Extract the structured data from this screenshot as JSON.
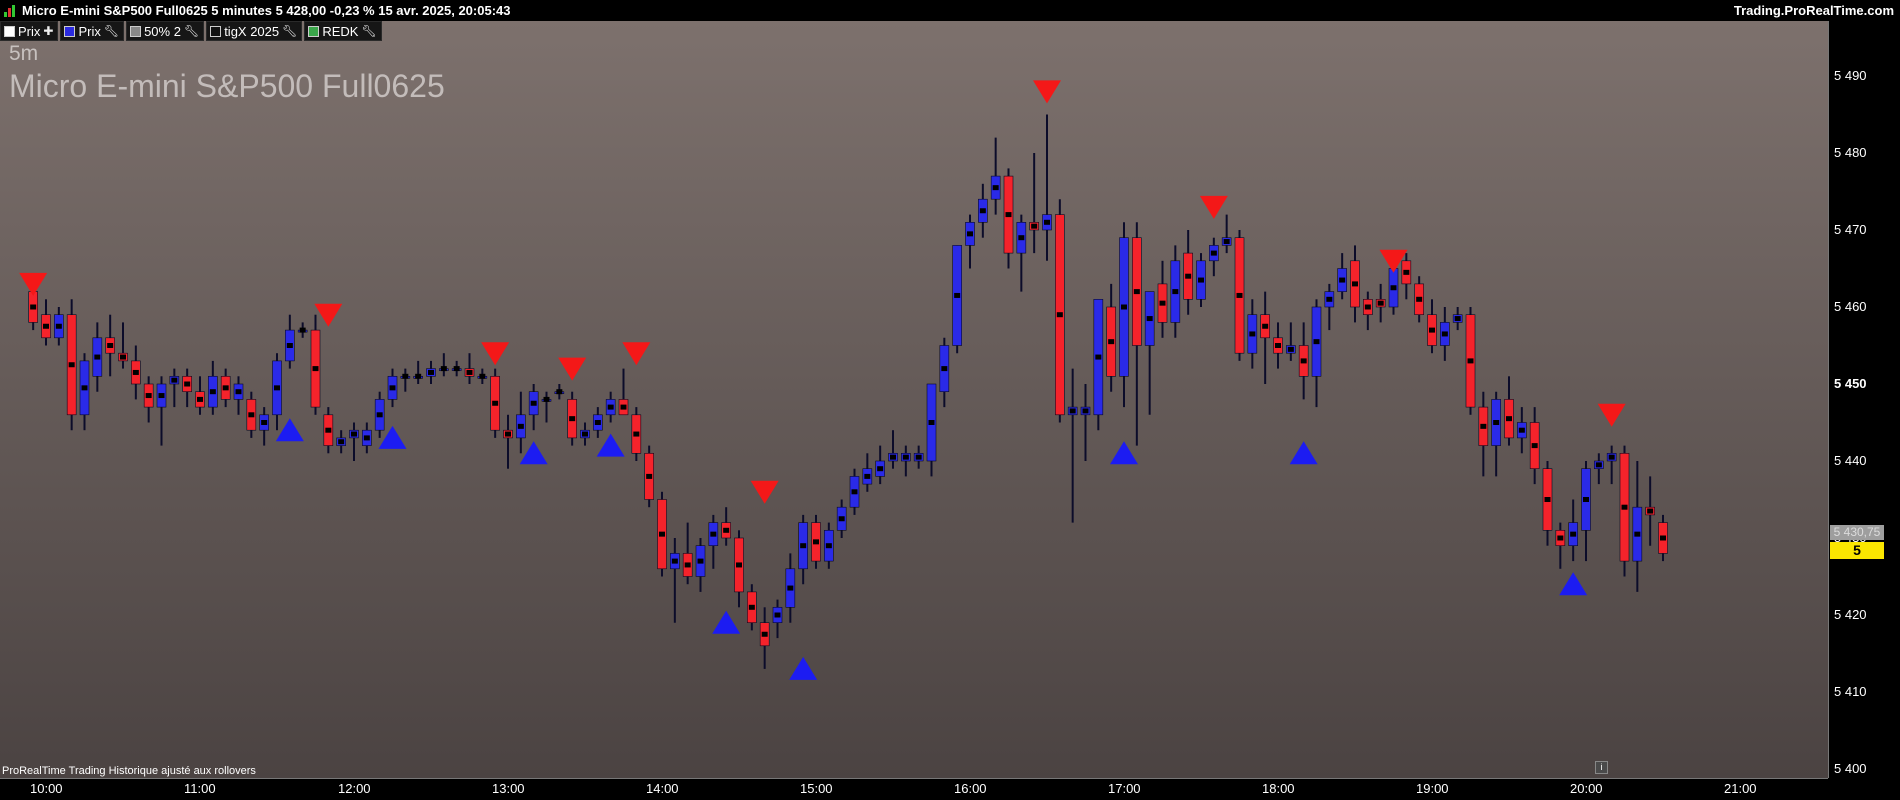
{
  "window": {
    "title": "Micro E-mini S&P500 Full0625 5 minutes 5 428,00 -0,23 % 15 avr. 2025, 20:05:43",
    "brand": "Trading.ProRealTime.com"
  },
  "legend": [
    {
      "label": "Prix",
      "color": "#ffffff",
      "icon": "plus-icon"
    },
    {
      "label": "Prix",
      "color": "#2b2be0",
      "icon": "wrench-icon"
    },
    {
      "label": "50% 2",
      "color": "#888888",
      "icon": "wrench-icon"
    },
    {
      "label": "tigX 2025",
      "color": "#111111",
      "icon": "wrench-icon"
    },
    {
      "label": "REDK",
      "color": "#3aa64a",
      "icon": "wrench-icon"
    }
  ],
  "overlay": {
    "timeframe": "5m",
    "instrument": "Micro E-mini S&P500 Full0625",
    "footer_note": "ProRealTime Trading  Historique ajusté aux rollovers",
    "info_icon": "i"
  },
  "price_labels": {
    "last": "5 428,25",
    "previous": "5 430,75"
  },
  "colors": {
    "up": "#2a2ae8",
    "down": "#f5232b",
    "wick": "#0c0c2a",
    "buy_signal": "#1c1cf2",
    "sell_signal": "#f41818",
    "bg_top": "#7d716d",
    "bg_bottom": "#4b4342"
  },
  "chart_data": {
    "type": "candlestick",
    "interval": "5 minutes",
    "x_range": [
      "09:55",
      "21:15"
    ],
    "ylim": [
      5400,
      5495
    ],
    "x_ticks": [
      "10:00",
      "11:00",
      "12:00",
      "13:00",
      "14:00",
      "15:00",
      "16:00",
      "17:00",
      "18:00",
      "19:00",
      "20:00",
      "21:00"
    ],
    "y_ticks": [
      {
        "value": 5400,
        "label": "5 400"
      },
      {
        "value": 5410,
        "label": "5 410"
      },
      {
        "value": 5420,
        "label": "5 420"
      },
      {
        "value": 5430,
        "label": "5 430"
      },
      {
        "value": 5440,
        "label": "5 440"
      },
      {
        "value": 5450,
        "label": "5 450"
      },
      {
        "value": 5460,
        "label": "5 460"
      },
      {
        "value": 5470,
        "label": "5 470"
      },
      {
        "value": 5480,
        "label": "5 480"
      },
      {
        "value": 5490,
        "label": "5 490"
      }
    ],
    "candles": [
      {
        "t": "09:55",
        "o": 5462,
        "h": 5463,
        "l": 5457,
        "c": 5458
      },
      {
        "t": "10:00",
        "o": 5459,
        "h": 5461,
        "l": 5455,
        "c": 5456
      },
      {
        "t": "10:05",
        "o": 5456,
        "h": 5460,
        "l": 5455,
        "c": 5459
      },
      {
        "t": "10:10",
        "o": 5459,
        "h": 5461,
        "l": 5444,
        "c": 5446
      },
      {
        "t": "10:15",
        "o": 5446,
        "h": 5454,
        "l": 5444,
        "c": 5453
      },
      {
        "t": "10:20",
        "o": 5451,
        "h": 5458,
        "l": 5449,
        "c": 5456
      },
      {
        "t": "10:25",
        "o": 5456,
        "h": 5459,
        "l": 5451,
        "c": 5454
      },
      {
        "t": "10:30",
        "o": 5454,
        "h": 5458,
        "l": 5452,
        "c": 5453
      },
      {
        "t": "10:35",
        "o": 5453,
        "h": 5455,
        "l": 5448,
        "c": 5450
      },
      {
        "t": "10:40",
        "o": 5450,
        "h": 5451,
        "l": 5445,
        "c": 5447
      },
      {
        "t": "10:45",
        "o": 5447,
        "h": 5451,
        "l": 5442,
        "c": 5450
      },
      {
        "t": "10:50",
        "o": 5450,
        "h": 5452,
        "l": 5447,
        "c": 5451
      },
      {
        "t": "10:55",
        "o": 5451,
        "h": 5452,
        "l": 5447,
        "c": 5449
      },
      {
        "t": "11:00",
        "o": 5449,
        "h": 5451,
        "l": 5446,
        "c": 5447
      },
      {
        "t": "11:05",
        "o": 5447,
        "h": 5453,
        "l": 5446,
        "c": 5451
      },
      {
        "t": "11:10",
        "o": 5451,
        "h": 5452,
        "l": 5447,
        "c": 5448
      },
      {
        "t": "11:15",
        "o": 5448,
        "h": 5451,
        "l": 5446,
        "c": 5450
      },
      {
        "t": "11:20",
        "o": 5448,
        "h": 5449,
        "l": 5443,
        "c": 5444
      },
      {
        "t": "11:25",
        "o": 5444,
        "h": 5447,
        "l": 5442,
        "c": 5446
      },
      {
        "t": "11:30",
        "o": 5446,
        "h": 5454,
        "l": 5444,
        "c": 5453
      },
      {
        "t": "11:35",
        "o": 5453,
        "h": 5459,
        "l": 5452,
        "c": 5457
      },
      {
        "t": "11:40",
        "o": 5457,
        "h": 5458,
        "l": 5456,
        "c": 5457
      },
      {
        "t": "11:45",
        "o": 5457,
        "h": 5459,
        "l": 5446,
        "c": 5447
      },
      {
        "t": "11:50",
        "o": 5446,
        "h": 5447,
        "l": 5441,
        "c": 5442
      },
      {
        "t": "11:55",
        "o": 5442,
        "h": 5444,
        "l": 5441,
        "c": 5443
      },
      {
        "t": "12:00",
        "o": 5443,
        "h": 5445,
        "l": 5440,
        "c": 5444
      },
      {
        "t": "12:05",
        "o": 5442,
        "h": 5445,
        "l": 5441,
        "c": 5444
      },
      {
        "t": "12:10",
        "o": 5444,
        "h": 5449,
        "l": 5443,
        "c": 5448
      },
      {
        "t": "12:15",
        "o": 5448,
        "h": 5452,
        "l": 5447,
        "c": 5451
      },
      {
        "t": "12:20",
        "o": 5451,
        "h": 5452,
        "l": 5449,
        "c": 5451
      },
      {
        "t": "12:25",
        "o": 5451,
        "h": 5453,
        "l": 5450,
        "c": 5451
      },
      {
        "t": "12:30",
        "o": 5451,
        "h": 5453,
        "l": 5450,
        "c": 5452
      },
      {
        "t": "12:35",
        "o": 5452,
        "h": 5454,
        "l": 5451,
        "c": 5452
      },
      {
        "t": "12:40",
        "o": 5452,
        "h": 5453,
        "l": 5451,
        "c": 5452
      },
      {
        "t": "12:45",
        "o": 5452,
        "h": 5454,
        "l": 5450,
        "c": 5451
      },
      {
        "t": "12:50",
        "o": 5451,
        "h": 5452,
        "l": 5450,
        "c": 5451
      },
      {
        "t": "12:55",
        "o": 5451,
        "h": 5452,
        "l": 5443,
        "c": 5444
      },
      {
        "t": "13:00",
        "o": 5444,
        "h": 5446,
        "l": 5439,
        "c": 5443
      },
      {
        "t": "13:05",
        "o": 5443,
        "h": 5449,
        "l": 5441,
        "c": 5446
      },
      {
        "t": "13:10",
        "o": 5446,
        "h": 5450,
        "l": 5444,
        "c": 5449
      },
      {
        "t": "13:15",
        "o": 5448,
        "h": 5449,
        "l": 5445,
        "c": 5448
      },
      {
        "t": "13:20",
        "o": 5449,
        "h": 5450,
        "l": 5448,
        "c": 5449
      },
      {
        "t": "13:25",
        "o": 5448,
        "h": 5449,
        "l": 5442,
        "c": 5443
      },
      {
        "t": "13:30",
        "o": 5443,
        "h": 5445,
        "l": 5442,
        "c": 5444
      },
      {
        "t": "13:35",
        "o": 5444,
        "h": 5447,
        "l": 5443,
        "c": 5446
      },
      {
        "t": "13:40",
        "o": 5446,
        "h": 5449,
        "l": 5445,
        "c": 5448
      },
      {
        "t": "13:45",
        "o": 5448,
        "h": 5452,
        "l": 5446,
        "c": 5446
      },
      {
        "t": "13:50",
        "o": 5446,
        "h": 5447,
        "l": 5440,
        "c": 5441
      },
      {
        "t": "13:55",
        "o": 5441,
        "h": 5442,
        "l": 5434,
        "c": 5435
      },
      {
        "t": "14:00",
        "o": 5435,
        "h": 5436,
        "l": 5425,
        "c": 5426
      },
      {
        "t": "14:05",
        "o": 5426,
        "h": 5430,
        "l": 5419,
        "c": 5428
      },
      {
        "t": "14:10",
        "o": 5428,
        "h": 5432,
        "l": 5424,
        "c": 5425
      },
      {
        "t": "14:15",
        "o": 5425,
        "h": 5430,
        "l": 5423,
        "c": 5429
      },
      {
        "t": "14:20",
        "o": 5429,
        "h": 5433,
        "l": 5426,
        "c": 5432
      },
      {
        "t": "14:25",
        "o": 5432,
        "h": 5434,
        "l": 5429,
        "c": 5430
      },
      {
        "t": "14:30",
        "o": 5430,
        "h": 5431,
        "l": 5421,
        "c": 5423
      },
      {
        "t": "14:35",
        "o": 5423,
        "h": 5424,
        "l": 5418,
        "c": 5419
      },
      {
        "t": "14:40",
        "o": 5419,
        "h": 5421,
        "l": 5413,
        "c": 5416
      },
      {
        "t": "14:45",
        "o": 5419,
        "h": 5422,
        "l": 5417,
        "c": 5421
      },
      {
        "t": "14:50",
        "o": 5421,
        "h": 5428,
        "l": 5419,
        "c": 5426
      },
      {
        "t": "14:55",
        "o": 5426,
        "h": 5433,
        "l": 5424,
        "c": 5432
      },
      {
        "t": "15:00",
        "o": 5432,
        "h": 5433,
        "l": 5426,
        "c": 5427
      },
      {
        "t": "15:05",
        "o": 5427,
        "h": 5432,
        "l": 5426,
        "c": 5431
      },
      {
        "t": "15:10",
        "o": 5431,
        "h": 5435,
        "l": 5430,
        "c": 5434
      },
      {
        "t": "15:15",
        "o": 5434,
        "h": 5439,
        "l": 5433,
        "c": 5438
      },
      {
        "t": "15:20",
        "o": 5437,
        "h": 5441,
        "l": 5436,
        "c": 5439
      },
      {
        "t": "15:25",
        "o": 5438,
        "h": 5442,
        "l": 5437,
        "c": 5440
      },
      {
        "t": "15:30",
        "o": 5440,
        "h": 5444,
        "l": 5439,
        "c": 5441
      },
      {
        "t": "15:35",
        "o": 5440,
        "h": 5442,
        "l": 5438,
        "c": 5441
      },
      {
        "t": "15:40",
        "o": 5440,
        "h": 5442,
        "l": 5439,
        "c": 5441
      },
      {
        "t": "15:45",
        "o": 5440,
        "h": 5450,
        "l": 5438,
        "c": 5450
      },
      {
        "t": "15:50",
        "o": 5449,
        "h": 5456,
        "l": 5447,
        "c": 5455
      },
      {
        "t": "15:55",
        "o": 5455,
        "h": 5468,
        "l": 5454,
        "c": 5468
      },
      {
        "t": "16:00",
        "o": 5468,
        "h": 5472,
        "l": 5465,
        "c": 5471
      },
      {
        "t": "16:05",
        "o": 5471,
        "h": 5476,
        "l": 5469,
        "c": 5474
      },
      {
        "t": "16:10",
        "o": 5474,
        "h": 5482,
        "l": 5472,
        "c": 5477
      },
      {
        "t": "16:15",
        "o": 5477,
        "h": 5478,
        "l": 5465,
        "c": 5467
      },
      {
        "t": "16:20",
        "o": 5467,
        "h": 5472,
        "l": 5462,
        "c": 5471
      },
      {
        "t": "16:25",
        "o": 5471,
        "h": 5480,
        "l": 5467,
        "c": 5470
      },
      {
        "t": "16:30",
        "o": 5470,
        "h": 5485,
        "l": 5466,
        "c": 5472
      },
      {
        "t": "16:35",
        "o": 5472,
        "h": 5474,
        "l": 5445,
        "c": 5446
      },
      {
        "t": "16:40",
        "o": 5446,
        "h": 5452,
        "l": 5432,
        "c": 5447
      },
      {
        "t": "16:45",
        "o": 5446,
        "h": 5450,
        "l": 5440,
        "c": 5447
      },
      {
        "t": "16:50",
        "o": 5446,
        "h": 5461,
        "l": 5444,
        "c": 5461
      },
      {
        "t": "16:55",
        "o": 5460,
        "h": 5463,
        "l": 5449,
        "c": 5451
      },
      {
        "t": "17:00",
        "o": 5451,
        "h": 5471,
        "l": 5447,
        "c": 5469
      },
      {
        "t": "17:05",
        "o": 5469,
        "h": 5471,
        "l": 5442,
        "c": 5455
      },
      {
        "t": "17:10",
        "o": 5455,
        "h": 5462,
        "l": 5446,
        "c": 5462
      },
      {
        "t": "17:15",
        "o": 5463,
        "h": 5466,
        "l": 5456,
        "c": 5458
      },
      {
        "t": "17:20",
        "o": 5458,
        "h": 5468,
        "l": 5456,
        "c": 5466
      },
      {
        "t": "17:25",
        "o": 5467,
        "h": 5470,
        "l": 5459,
        "c": 5461
      },
      {
        "t": "17:30",
        "o": 5461,
        "h": 5467,
        "l": 5460,
        "c": 5466
      },
      {
        "t": "17:35",
        "o": 5466,
        "h": 5469,
        "l": 5464,
        "c": 5468
      },
      {
        "t": "17:40",
        "o": 5468,
        "h": 5472,
        "l": 5467,
        "c": 5469
      },
      {
        "t": "17:45",
        "o": 5469,
        "h": 5470,
        "l": 5453,
        "c": 5454
      },
      {
        "t": "17:50",
        "o": 5454,
        "h": 5461,
        "l": 5452,
        "c": 5459
      },
      {
        "t": "17:55",
        "o": 5459,
        "h": 5462,
        "l": 5450,
        "c": 5456
      },
      {
        "t": "18:00",
        "o": 5456,
        "h": 5458,
        "l": 5452,
        "c": 5454
      },
      {
        "t": "18:05",
        "o": 5454,
        "h": 5458,
        "l": 5453,
        "c": 5455
      },
      {
        "t": "18:10",
        "o": 5455,
        "h": 5458,
        "l": 5448,
        "c": 5451
      },
      {
        "t": "18:15",
        "o": 5451,
        "h": 5461,
        "l": 5447,
        "c": 5460
      },
      {
        "t": "18:20",
        "o": 5460,
        "h": 5463,
        "l": 5457,
        "c": 5462
      },
      {
        "t": "18:25",
        "o": 5462,
        "h": 5467,
        "l": 5461,
        "c": 5465
      },
      {
        "t": "18:30",
        "o": 5466,
        "h": 5468,
        "l": 5458,
        "c": 5460
      },
      {
        "t": "18:35",
        "o": 5461,
        "h": 5462,
        "l": 5457,
        "c": 5459
      },
      {
        "t": "18:40",
        "o": 5461,
        "h": 5463,
        "l": 5458,
        "c": 5460
      },
      {
        "t": "18:45",
        "o": 5460,
        "h": 5466,
        "l": 5459,
        "c": 5465
      },
      {
        "t": "18:50",
        "o": 5466,
        "h": 5467,
        "l": 5461,
        "c": 5463
      },
      {
        "t": "18:55",
        "o": 5463,
        "h": 5464,
        "l": 5458,
        "c": 5459
      },
      {
        "t": "19:00",
        "o": 5459,
        "h": 5461,
        "l": 5454,
        "c": 5455
      },
      {
        "t": "19:05",
        "o": 5455,
        "h": 5460,
        "l": 5453,
        "c": 5458
      },
      {
        "t": "19:10",
        "o": 5458,
        "h": 5460,
        "l": 5457,
        "c": 5459
      },
      {
        "t": "19:15",
        "o": 5459,
        "h": 5460,
        "l": 5446,
        "c": 5447
      },
      {
        "t": "19:20",
        "o": 5447,
        "h": 5449,
        "l": 5438,
        "c": 5442
      },
      {
        "t": "19:25",
        "o": 5442,
        "h": 5449,
        "l": 5438,
        "c": 5448
      },
      {
        "t": "19:30",
        "o": 5448,
        "h": 5451,
        "l": 5442,
        "c": 5443
      },
      {
        "t": "19:35",
        "o": 5443,
        "h": 5447,
        "l": 5441,
        "c": 5445
      },
      {
        "t": "19:40",
        "o": 5445,
        "h": 5447,
        "l": 5437,
        "c": 5439
      },
      {
        "t": "19:45",
        "o": 5439,
        "h": 5440,
        "l": 5429,
        "c": 5431
      },
      {
        "t": "19:50",
        "o": 5431,
        "h": 5432,
        "l": 5426,
        "c": 5429
      },
      {
        "t": "19:55",
        "o": 5429,
        "h": 5435,
        "l": 5427,
        "c": 5432
      },
      {
        "t": "20:00",
        "o": 5431,
        "h": 5440,
        "l": 5427,
        "c": 5439
      },
      {
        "t": "20:05",
        "o": 5439,
        "h": 5441,
        "l": 5437,
        "c": 5440
      },
      {
        "t": "20:10",
        "o": 5440,
        "h": 5442,
        "l": 5437,
        "c": 5441
      },
      {
        "t": "20:15",
        "o": 5441,
        "h": 5442,
        "l": 5425,
        "c": 5427
      },
      {
        "t": "20:20",
        "o": 5427,
        "h": 5440,
        "l": 5423,
        "c": 5434
      },
      {
        "t": "20:25",
        "o": 5434,
        "h": 5438,
        "l": 5429,
        "c": 5433
      },
      {
        "t": "20:30",
        "o": 5432,
        "h": 5433,
        "l": 5427,
        "c": 5428
      }
    ],
    "signals": [
      {
        "t": "09:55",
        "type": "sell",
        "price": 5463
      },
      {
        "t": "11:35",
        "type": "buy",
        "price": 5444
      },
      {
        "t": "11:50",
        "type": "sell",
        "price": 5459
      },
      {
        "t": "12:15",
        "type": "buy",
        "price": 5443
      },
      {
        "t": "12:55",
        "type": "sell",
        "price": 5454
      },
      {
        "t": "13:10",
        "type": "buy",
        "price": 5441
      },
      {
        "t": "13:25",
        "type": "sell",
        "price": 5452
      },
      {
        "t": "13:40",
        "type": "buy",
        "price": 5442
      },
      {
        "t": "13:50",
        "type": "sell",
        "price": 5454
      },
      {
        "t": "14:25",
        "type": "buy",
        "price": 5419
      },
      {
        "t": "14:40",
        "type": "sell",
        "price": 5436
      },
      {
        "t": "14:55",
        "type": "buy",
        "price": 5413
      },
      {
        "t": "16:30",
        "type": "sell",
        "price": 5488
      },
      {
        "t": "17:00",
        "type": "buy",
        "price": 5441
      },
      {
        "t": "17:35",
        "type": "sell",
        "price": 5473
      },
      {
        "t": "18:10",
        "type": "buy",
        "price": 5441
      },
      {
        "t": "18:45",
        "type": "sell",
        "price": 5466
      },
      {
        "t": "19:55",
        "type": "buy",
        "price": 5424
      },
      {
        "t": "20:10",
        "type": "sell",
        "price": 5446
      }
    ]
  }
}
